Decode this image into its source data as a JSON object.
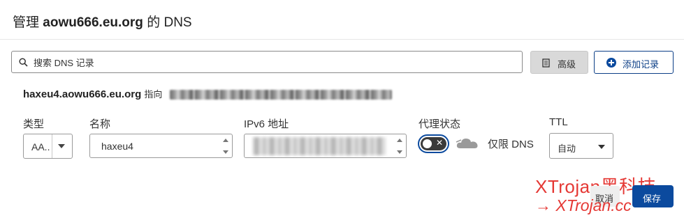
{
  "dialog": {
    "title_prefix": "管理",
    "title_domain": "aowu666.eu.org",
    "title_suffix": "的 DNS"
  },
  "toolbar": {
    "search_placeholder": "搜索 DNS 记录",
    "advanced_label": "高级",
    "add_record_label": "添加记录"
  },
  "record": {
    "host": "haxeu4.aowu666.eu.org",
    "points_to_label": "指向"
  },
  "form": {
    "type_label": "类型",
    "type_value": "AA..",
    "name_label": "名称",
    "name_value": "haxeu4",
    "ip_label": "IPv6 地址",
    "proxy_label": "代理状态",
    "proxy_status_text": "仅限 DNS",
    "proxy_enabled": false,
    "ttl_label": "TTL",
    "ttl_value": "自动"
  },
  "actions": {
    "cancel_label": "取消",
    "save_label": "保存"
  },
  "watermark": {
    "line1": "XTrojan黑科技",
    "line2": "→ XTrojan.cc"
  },
  "colors": {
    "primary": "#0b4a9e",
    "watermark": "#e53935"
  }
}
